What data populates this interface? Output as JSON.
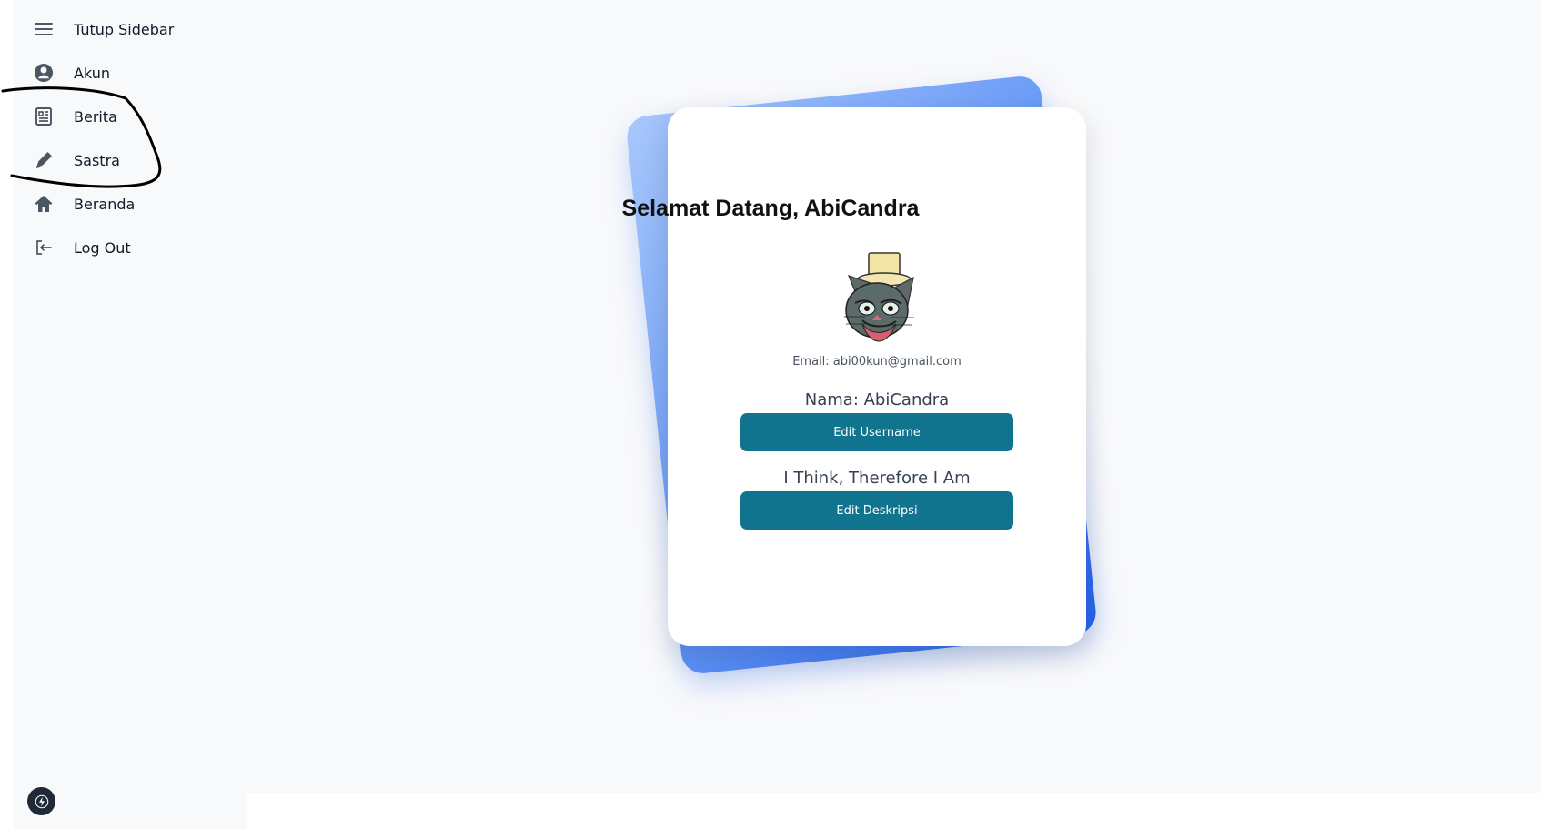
{
  "sidebar": {
    "items": [
      {
        "label": "Tutup Sidebar",
        "icon": "menu-icon"
      },
      {
        "label": "Akun",
        "icon": "user-circle-icon"
      },
      {
        "label": "Berita",
        "icon": "newspaper-icon"
      },
      {
        "label": "Sastra",
        "icon": "pen-icon"
      },
      {
        "label": "Beranda",
        "icon": "home-icon"
      },
      {
        "label": "Log Out",
        "icon": "logout-icon"
      }
    ]
  },
  "profile": {
    "greeting": "Selamat Datang, AbiCandra",
    "email": "Email: abi00kun@gmail.com",
    "name": "Nama: AbiCandra",
    "edit_username_label": "Edit Username",
    "description": "I Think, Therefore I Am",
    "edit_description_label": "Edit Deskripsi",
    "avatar_icon": "cat-top-hat-avatar"
  },
  "colors": {
    "page_background": "#f8f9fb",
    "button": "#11748f",
    "accent_blue": "#2563eb",
    "card": "#ffffff"
  }
}
